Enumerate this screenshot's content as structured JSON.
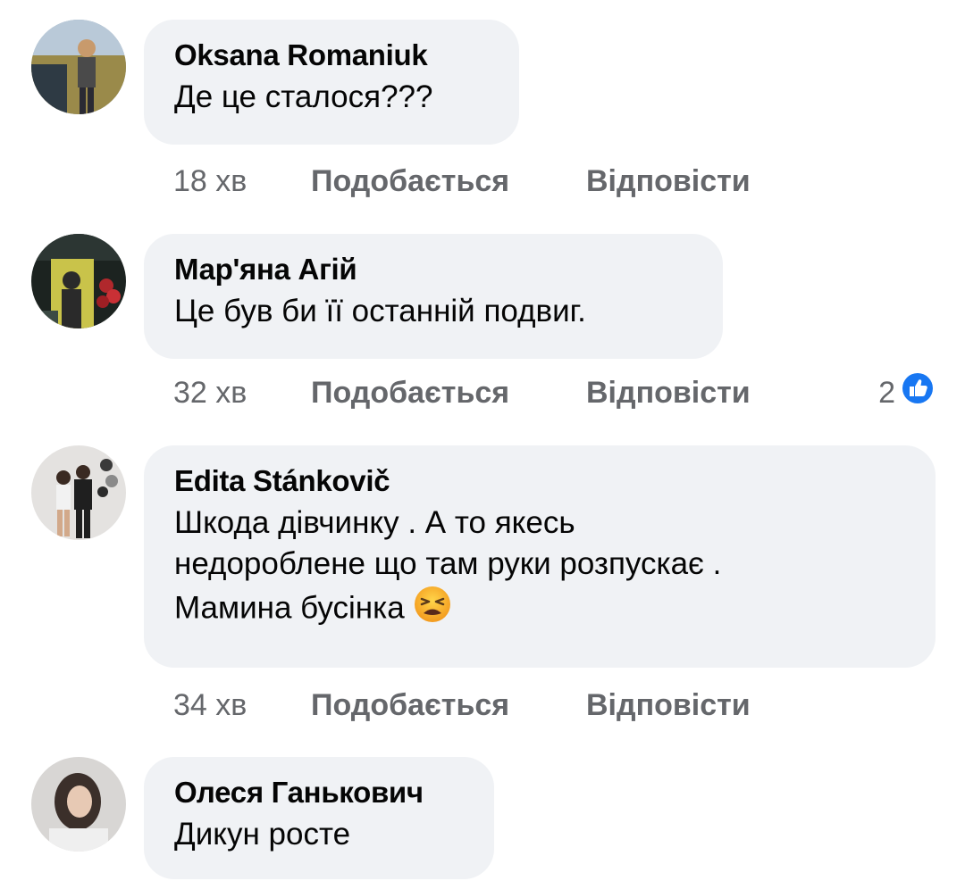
{
  "comments": [
    {
      "author": "Oksana Romaniuk",
      "text_lines": [
        "Де це сталося???"
      ],
      "time": "18 хв",
      "like_label": "Подобається",
      "reply_label": "Відповісти"
    },
    {
      "author": "Мар'яна Агій",
      "text_lines": [
        "Це був би її останній подвиг."
      ],
      "time": "32 хв",
      "like_label": "Подобається",
      "reply_label": "Відповісти",
      "reaction_count": "2",
      "reaction_icon": "like-icon"
    },
    {
      "author": "Edita Stánkovič",
      "text_lines": [
        "Шкода дівчинку . А то якесь",
        "недороблене що там руки розпускає .",
        "Мамина бусінка"
      ],
      "emoji": "tired-face-emoji",
      "time": "34 хв",
      "like_label": "Подобається",
      "reply_label": "Відповісти"
    },
    {
      "author": "Олеся Ганькович",
      "text_lines": [
        "Дикун росте"
      ]
    }
  ],
  "colors": {
    "bubble": "#f0f2f5",
    "meta": "#65676b",
    "text": "#050505",
    "like_blue": "#1877f2"
  }
}
